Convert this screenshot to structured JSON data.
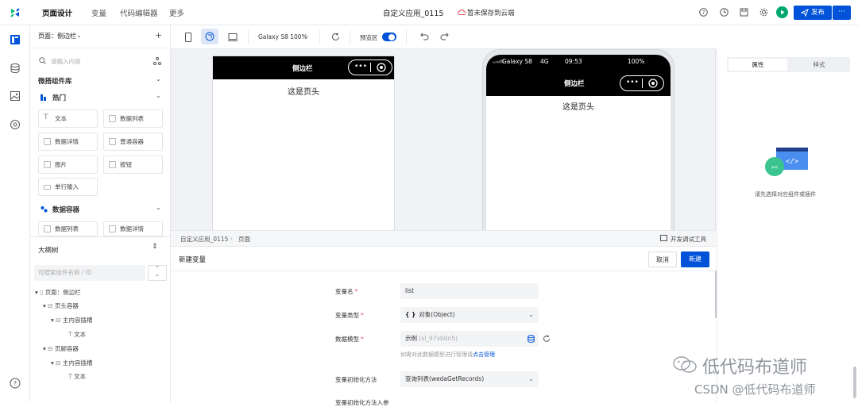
{
  "top": {
    "tabs": [
      "页面设计",
      "变量",
      "代码编辑器",
      "更多"
    ],
    "app_title": "自定义应用_0115",
    "save_status": "暂未保存到云端",
    "publish_label": "发布",
    "more_label": "···"
  },
  "left_panel": {
    "page_selector": "页面：侧边栏",
    "add_label": "+",
    "search_placeholder": "请输入内容",
    "library_title": "微搭组件库",
    "hot_group": "热门",
    "hot_items": [
      "文本",
      "数据列表",
      "数据详情",
      "普通容器",
      "图片",
      "按钮",
      "单行输入"
    ],
    "data_group": "数据容器",
    "data_items": [
      "数据列表",
      "数据详情"
    ],
    "outline_title": "大纲树",
    "outline_search_placeholder": "可搜索组件名称 / ID",
    "tree": [
      "页面：侧边栏",
      "页头容器",
      "主内容插槽",
      "文本",
      "页脚容器",
      "主内容插槽",
      "文本"
    ]
  },
  "canvas_toolbar": {
    "device_label": "Galaxy S8 100%",
    "preview_label": "预览区"
  },
  "canvas": {
    "left_frame": {
      "title": "侧边栏",
      "header_text": "这是页头"
    },
    "phone": {
      "carrier": "Galaxy S8",
      "network": "4G",
      "time": "09:53",
      "battery": "100%",
      "title": "侧边栏",
      "header_text": "这是页头"
    }
  },
  "breadcrumb": {
    "app": "自定义应用_0115",
    "sep": "›",
    "page": "页面",
    "dev_tools": "开发调试工具"
  },
  "form": {
    "title": "新建变量",
    "cancel_label": "取消",
    "create_label": "新建",
    "fields": {
      "name_label": "变量名",
      "name_value": "list",
      "type_label": "变量类型",
      "type_icon": "{ }",
      "type_value": "对象(Object)",
      "model_label": "数据模型",
      "model_value": "示例",
      "model_id": "(sl_97vb0n5)",
      "model_hint_prefix": "如需对此数据模型进行管理请",
      "model_hint_link": "点击管理",
      "init_label": "变量初始化方法",
      "init_value": "查询列表(wedaGetRecords)",
      "init_params_label": "变量初始化方法入参"
    }
  },
  "right_panel": {
    "tabs": [
      "属性",
      "样式"
    ],
    "empty_text": "请先选择对应组件或插件"
  },
  "watermark": {
    "line1": "低代码布道师",
    "line2": "CSDN @低代码布道师"
  },
  "colors": {
    "accent": "#0052d9",
    "run_green": "#00a870",
    "danger": "#e34d59"
  }
}
